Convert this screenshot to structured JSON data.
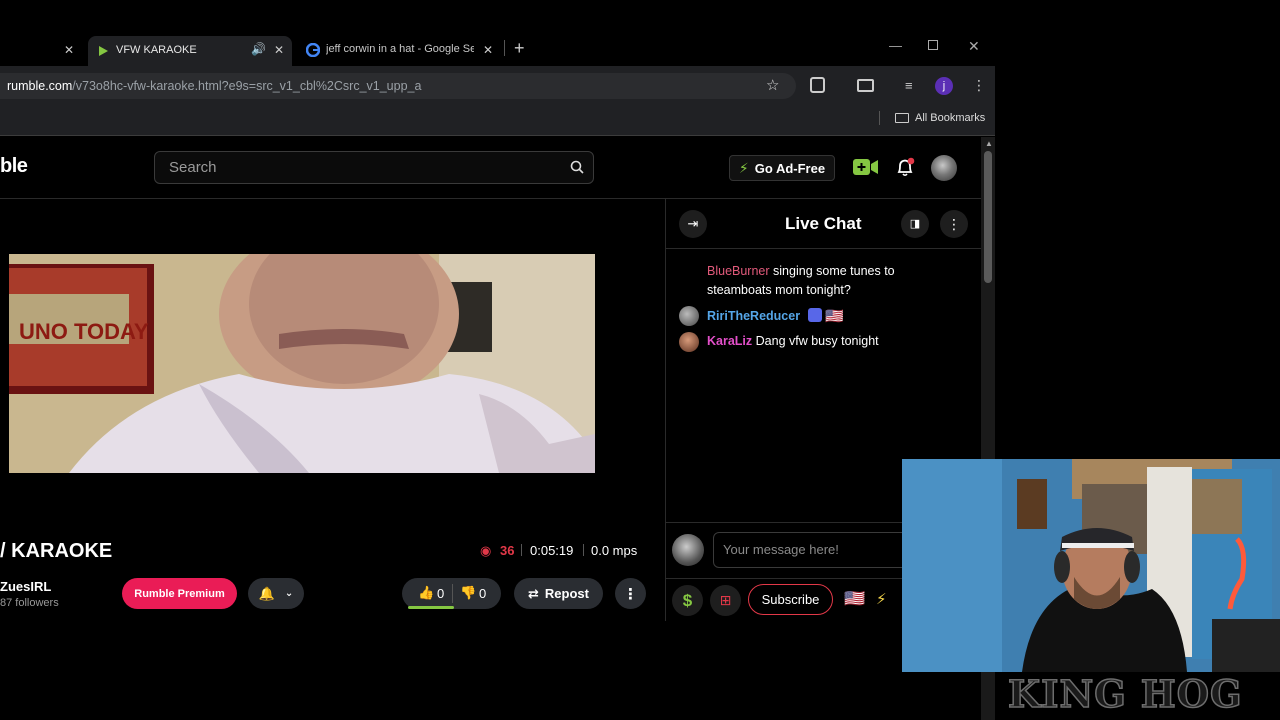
{
  "browser": {
    "tabs": [
      {
        "title": ""
      },
      {
        "title": "VFW KARAOKE"
      },
      {
        "title": "jeff corwin in a hat - Google Se"
      }
    ],
    "new_tab": "+",
    "url_domain": "rumble.com",
    "url_path": "/v73o8hc-vfw-karaoke.html?e9s=src_v1_cbl%2Csrc_v1_upp_a",
    "profile_initial": "j",
    "bookmarks_label": "All Bookmarks"
  },
  "site": {
    "logo_text": "ble",
    "search_placeholder": "Search",
    "go_ad_free": "Go Ad-Free"
  },
  "video": {
    "title": "/ KARAOKE",
    "channel": "ZuesIRL",
    "followers": "87 followers",
    "premium_label": "Rumble Premium",
    "viewers": "36",
    "duration": "0:05:19",
    "mps": "0.0 mps",
    "likes": "0",
    "dislikes": "0",
    "repost_label": "Repost"
  },
  "chat": {
    "title": "Live Chat",
    "messages": [
      {
        "user": "BlueBurner",
        "text": "singing some tunes to steamboats mom tonight?",
        "color": "#e25a7b"
      },
      {
        "user": "RiriTheReducer",
        "text": "",
        "color": "#55a6e8"
      },
      {
        "user": "KaraLiz",
        "text": "Dang vfw busy tonight",
        "color": "#e34fc9"
      }
    ],
    "input_placeholder": "Your message here!",
    "subscribe_label": "Subscribe"
  },
  "overlay": {
    "brand": "KING HOG"
  },
  "colors": {
    "rumble_green": "#85c742",
    "premium_pink": "#ea1c56",
    "viewer_red": "#e23848"
  }
}
